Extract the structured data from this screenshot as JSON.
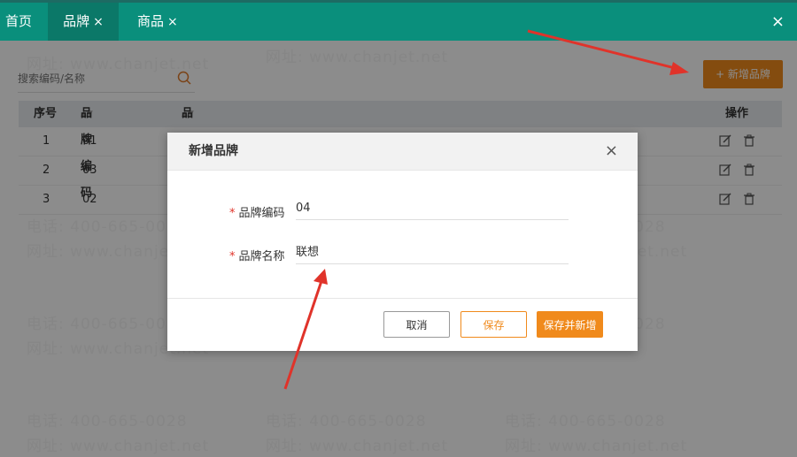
{
  "tabs": [
    {
      "label": "首页",
      "closable": false
    },
    {
      "label": "品牌",
      "closable": true,
      "active": true
    },
    {
      "label": "商品",
      "closable": true
    }
  ],
  "close_glyph": "×",
  "search": {
    "placeholder": "搜索编码/名称"
  },
  "add_button": {
    "label": "+ 新增品牌"
  },
  "table": {
    "columns": [
      "序号",
      "品牌编码",
      "品牌名称",
      "操作"
    ],
    "rows": [
      {
        "index": "1",
        "code": "01"
      },
      {
        "index": "2",
        "code": "03"
      },
      {
        "index": "3",
        "code": "02"
      }
    ]
  },
  "watermark": {
    "phone": "电话: 400-665-0028",
    "site": "网址: www.chanjet.net"
  },
  "dialog": {
    "title": "新增品牌",
    "fields": [
      {
        "label": "品牌编码",
        "required_mark": "*",
        "value": "04"
      },
      {
        "label": "品牌名称",
        "required_mark": "*",
        "value": "联想"
      }
    ],
    "buttons": {
      "cancel": "取消",
      "save": "保存",
      "save_new": "保存并新增"
    }
  },
  "colors": {
    "topbar": "#0a8f7c",
    "accent": "#f08a1c",
    "annotation_arrow": "#e0332a"
  }
}
